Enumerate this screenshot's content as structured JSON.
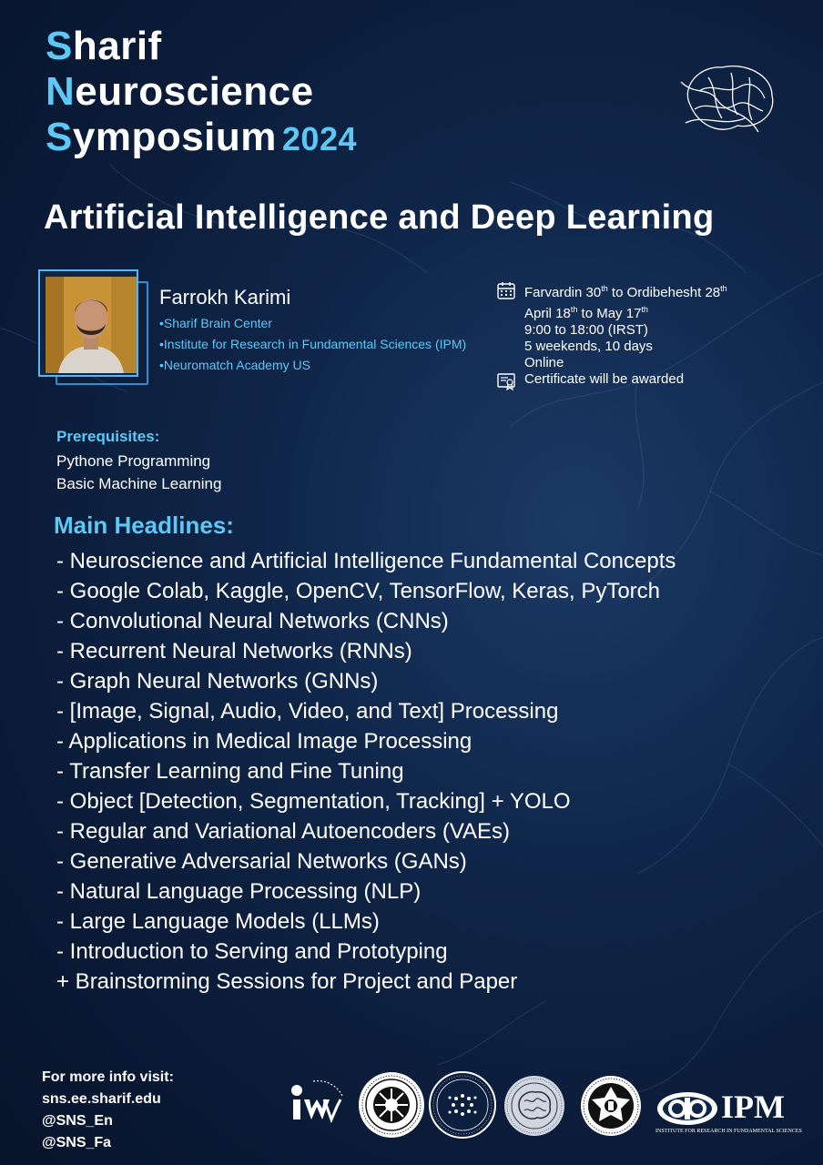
{
  "symposium": {
    "line1_initial": "S",
    "line1_rest": "harif",
    "line2_initial": "N",
    "line2_rest": "euroscience",
    "line3_initial": "S",
    "line3_rest": "ymposium",
    "year": "2024"
  },
  "course_title": "Artificial Intelligence and Deep Learning",
  "speaker": {
    "name": "Farrokh Karimi",
    "affiliations": [
      "•Sharif Brain Center",
      "•Institute for Research in Fundamental Sciences (IPM)",
      "•Neuromatch Academy US"
    ]
  },
  "schedule": {
    "persian_dates_a": "Farvardin 30",
    "persian_sup_a": "th",
    "persian_dates_b": " to Ordibehesht 28",
    "persian_sup_b": "th",
    "dates_a": "April 18",
    "dates_sup_a": "th",
    "dates_b": " to May 17",
    "dates_sup_b": "th",
    "time": "9:00 to 18:00 (IRST)",
    "duration": "5 weekends, 10 days",
    "mode": "Online",
    "certificate": "Certificate will be awarded"
  },
  "prerequisites": {
    "label": "Prerequisites:",
    "items": [
      "Pythone Programming",
      "Basic Machine Learning"
    ]
  },
  "headlines": {
    "title": "Main Headlines:",
    "items": [
      "- Neuroscience and Artificial Intelligence Fundamental Concepts",
      "- Google Colab, Kaggle, OpenCV, TensorFlow, Keras, PyTorch",
      "- Convolutional Neural Networks (CNNs)",
      "- Recurrent Neural Networks (RNNs)",
      "- Graph Neural Networks (GNNs)",
      "- [Image, Signal, Audio, Video, and Text] Processing",
      "- Applications in Medical Image Processing",
      "- Transfer Learning and Fine Tuning",
      "- Object [Detection, Segmentation, Tracking] + YOLO",
      "- Regular and Variational Autoencoders (VAEs)",
      "- Generative Adversarial Networks (GANs)",
      "- Natural Language Processing (NLP)",
      "- Large Language Models (LLMs)",
      "- Introduction to Serving and Prototyping",
      "+ Brainstorming Sessions for Project and Paper"
    ]
  },
  "contact": {
    "label": "For more info visit:",
    "website": "sns.ee.sharif.edu",
    "handle_en": "@SNS_En",
    "handle_fa": "@SNS_Fa"
  },
  "logos": {
    "ipm_text": "IPM",
    "ipm_caption": "INSTITUTE FOR RESEARCH IN FUNDAMENTAL SCIENCES"
  },
  "colors": {
    "accent": "#5ec8f5",
    "background": "#0f2548",
    "text": "#ffffff"
  }
}
